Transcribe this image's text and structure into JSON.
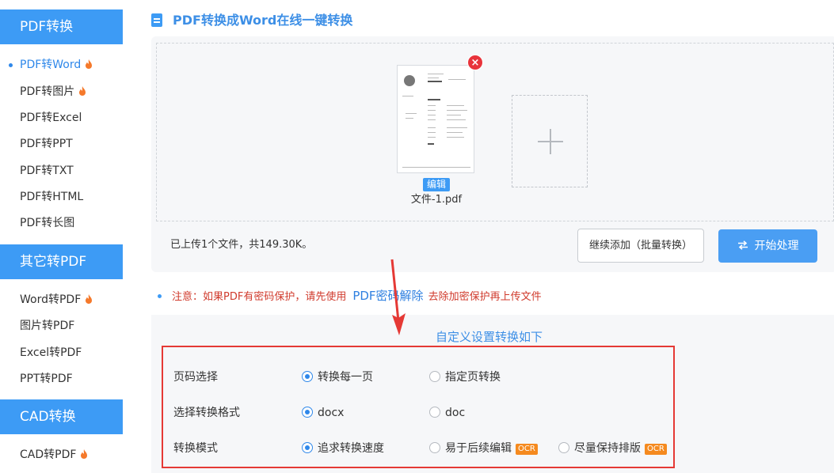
{
  "sidebar": {
    "sections": [
      {
        "title": "PDF转换"
      },
      {
        "title": "其它转PDF"
      },
      {
        "title": "CAD转换"
      }
    ],
    "items": [
      {
        "label": "PDF转Word",
        "hot": true,
        "active": true
      },
      {
        "label": "PDF转图片",
        "hot": true
      },
      {
        "label": "PDF转Excel"
      },
      {
        "label": "PDF转PPT"
      },
      {
        "label": "PDF转TXT"
      },
      {
        "label": "PDF转HTML"
      },
      {
        "label": "PDF转长图"
      },
      {
        "label": "Word转PDF",
        "hot": true
      },
      {
        "label": "图片转PDF"
      },
      {
        "label": "Excel转PDF"
      },
      {
        "label": "PPT转PDF"
      },
      {
        "label": "CAD转PDF",
        "hot": true
      }
    ]
  },
  "page": {
    "title": "PDF转换成Word在线一键转换"
  },
  "upload": {
    "close_label": "×",
    "edit_label": "编辑",
    "file_name": "文件-1.pdf",
    "status": "已上传1个文件，共149.30K。",
    "continue_label": "继续添加（批量转换）",
    "start_label": "开始处理"
  },
  "notice": {
    "prefix": "注意：如果PDF有密码保护，请先使用",
    "link": "PDF密码解除",
    "suffix": "去除加密保护再上传文件"
  },
  "settings": {
    "title": "自定义设置转换如下",
    "rows": [
      {
        "label": "页码选择",
        "options": [
          {
            "label": "转换每一页",
            "selected": true
          },
          {
            "label": "指定页转换",
            "selected": false
          }
        ]
      },
      {
        "label": "选择转换格式",
        "options": [
          {
            "label": "docx",
            "selected": true
          },
          {
            "label": "doc",
            "selected": false
          }
        ]
      },
      {
        "label": "转换模式",
        "options": [
          {
            "label": "追求转换速度",
            "selected": true
          },
          {
            "label": "易于后续编辑",
            "selected": false,
            "badge": "OCR"
          },
          {
            "label": "尽量保持排版",
            "selected": false,
            "badge": "OCR"
          }
        ]
      }
    ]
  },
  "colors": {
    "accent": "#3d9bf5",
    "warning": "#d03a2c",
    "highlight_box": "#e53935",
    "ocr_badge": "#f58a1f"
  }
}
